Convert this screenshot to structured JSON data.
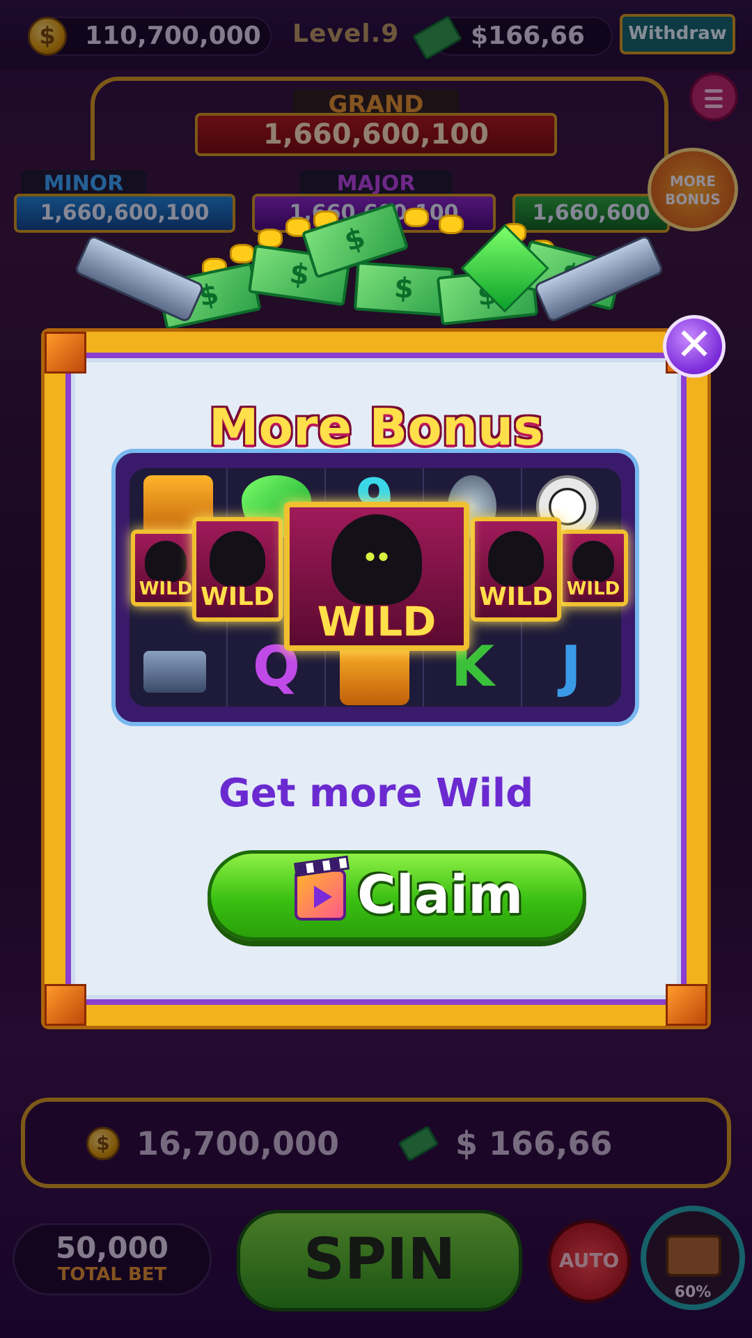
{
  "topbar": {
    "coins": "110,700,000",
    "level": "Level.9",
    "cash": "$166,66",
    "withdraw_label": "Withdraw"
  },
  "jackpots": {
    "grand_label": "GRAND",
    "grand_value": "1,660,600,100",
    "minor_label": "MINOR",
    "minor_value": "1,660,600,100",
    "major_label": "MAJOR",
    "major_value": "1,660,600,100",
    "mini_value": "1,660,600"
  },
  "more_bonus_badge": "MORE BONUS",
  "modal": {
    "title": "More Bonus",
    "close_label": "✕",
    "subtitle": "Get more Wild",
    "claim_label": "Claim",
    "reels": [
      {
        "top": "safe",
        "bottom": "revolver"
      },
      {
        "top": "emerald",
        "bottom": "Q"
      },
      {
        "top": "9",
        "bottom": "safe"
      },
      {
        "top": "grenade",
        "bottom": "K"
      },
      {
        "top": "chip",
        "bottom": "J"
      }
    ],
    "wild_text": "WILD"
  },
  "bottom": {
    "bet_coins": "16,700,000",
    "bet_cash": "$ 166,66",
    "total_bet_value": "50,000",
    "total_bet_label": "TOTAL BET",
    "spin_label": "SPIN",
    "auto_label": "AUTO",
    "chest_progress": "60%"
  },
  "colors": {
    "frame_gold": "#f2b21c",
    "modal_bg": "#e4ecf6",
    "claim_green": "#3ac012",
    "title_yellow": "#ffe04a",
    "subtitle_purple": "#6a2ad0",
    "close_purple": "#7a2ad8"
  }
}
